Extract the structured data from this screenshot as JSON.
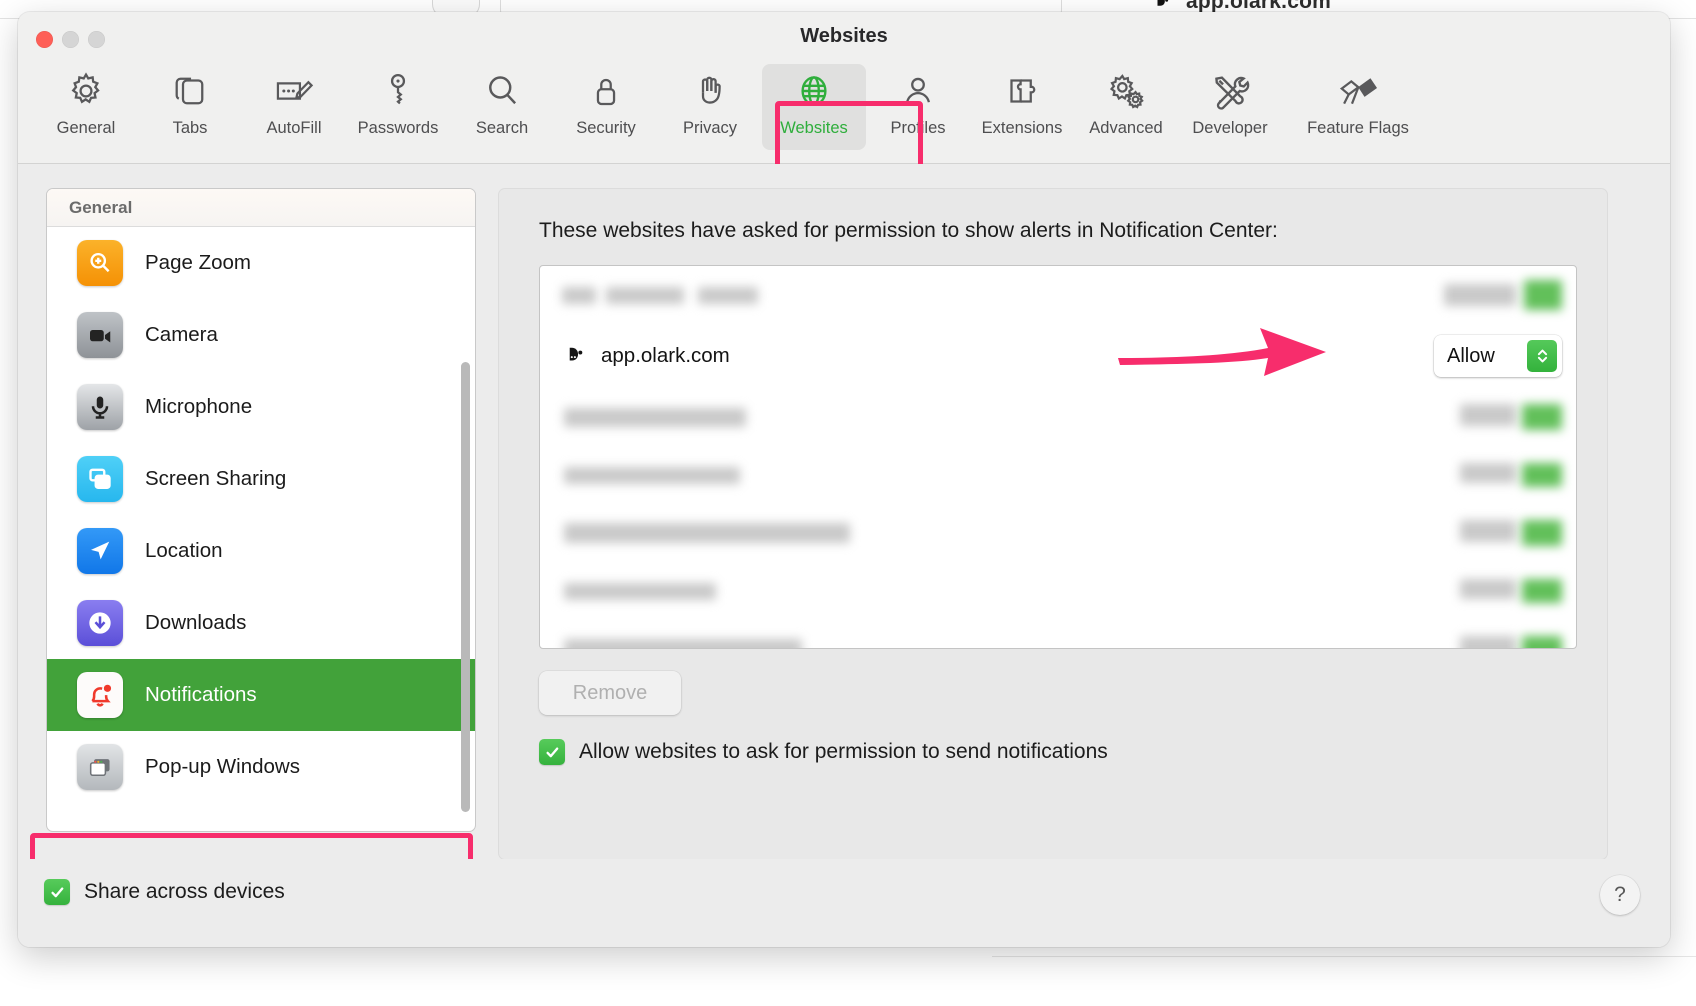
{
  "background": {
    "page_title": "app.olark.com"
  },
  "window": {
    "title": "Websites"
  },
  "toolbar": {
    "items": [
      {
        "label": "General",
        "icon": "gear-icon",
        "selected": false
      },
      {
        "label": "Tabs",
        "icon": "tabs-icon",
        "selected": false
      },
      {
        "label": "AutoFill",
        "icon": "autofill-icon",
        "selected": false
      },
      {
        "label": "Passwords",
        "icon": "key-icon",
        "selected": false
      },
      {
        "label": "Search",
        "icon": "search-icon",
        "selected": false
      },
      {
        "label": "Security",
        "icon": "lock-icon",
        "selected": false
      },
      {
        "label": "Privacy",
        "icon": "hand-icon",
        "selected": false
      },
      {
        "label": "Websites",
        "icon": "globe-icon",
        "selected": true
      },
      {
        "label": "Profiles",
        "icon": "person-icon",
        "selected": false
      },
      {
        "label": "Extensions",
        "icon": "puzzle-icon",
        "selected": false
      },
      {
        "label": "Advanced",
        "icon": "gears-icon",
        "selected": false
      },
      {
        "label": "Developer",
        "icon": "tools-icon",
        "selected": false
      },
      {
        "label": "Feature Flags",
        "icon": "flags-icon",
        "selected": false
      }
    ]
  },
  "sidebar": {
    "header": "General",
    "items": [
      {
        "label": "Page Zoom",
        "icon": "page-zoom-icon",
        "selected": false
      },
      {
        "label": "Camera",
        "icon": "camera-icon",
        "selected": false
      },
      {
        "label": "Microphone",
        "icon": "microphone-icon",
        "selected": false
      },
      {
        "label": "Screen Sharing",
        "icon": "screen-sharing-icon",
        "selected": false
      },
      {
        "label": "Location",
        "icon": "location-icon",
        "selected": false
      },
      {
        "label": "Downloads",
        "icon": "downloads-icon",
        "selected": false
      },
      {
        "label": "Notifications",
        "icon": "notifications-icon",
        "selected": true
      },
      {
        "label": "Pop-up Windows",
        "icon": "popup-windows-icon",
        "selected": false
      }
    ]
  },
  "main": {
    "description": "These websites have asked for permission to show alerts in Notification Center:",
    "site": {
      "name": "app.olark.com",
      "favicon": "olark-favicon-icon",
      "permission": "Allow"
    },
    "remove_label": "Remove",
    "ask_permission_label": "Allow websites to ask for permission to send notifications",
    "ask_permission_checked": true
  },
  "footer": {
    "share_label": "Share across devices",
    "share_checked": true,
    "help_label": "?"
  },
  "annotations": {
    "accent_color": "#f72d6c",
    "highlighted_tab": "Websites",
    "highlighted_sidebar_item": "Notifications",
    "arrow_points_to": "Allow"
  },
  "colors": {
    "selection_green": "#42a23a",
    "accent_pink": "#f72d6c",
    "control_green": "#35b23d"
  }
}
